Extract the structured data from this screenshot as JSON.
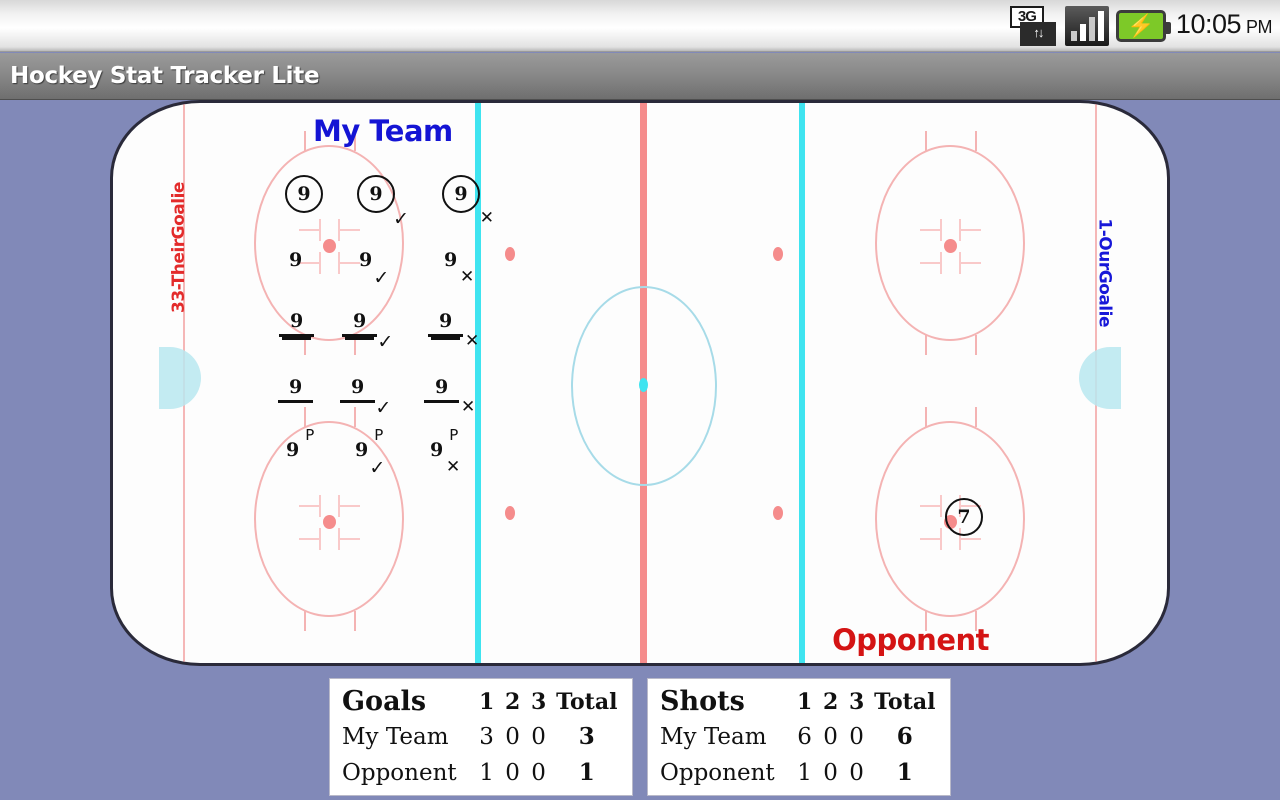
{
  "statusbar": {
    "network_label": "3G",
    "network_arrows": "↑↓",
    "battery_glyph": "⚡",
    "time": "10:05",
    "ampm": "PM"
  },
  "titlebar": {
    "app_title": "Hockey Stat Tracker Lite"
  },
  "rink": {
    "my_team_label": "My Team",
    "opponent_label": "Opponent",
    "their_goalie_label": "33-TheirGoalie",
    "our_goalie_label": "1-OurGoalie",
    "colors": {
      "background": "#8189b8",
      "ice": "#fdfdfd",
      "blue_line": "#3fe4f0",
      "red_line": "#f58c8c",
      "faceoff": "#f4b3b3",
      "crease": "#b8e8f0",
      "my_team": "#1414d4",
      "opponent": "#d41414"
    },
    "markers": [
      {
        "number": "9",
        "style": "circled",
        "mod": "",
        "penalty": false
      },
      {
        "number": "9",
        "style": "circled",
        "mod": "check",
        "penalty": false
      },
      {
        "number": "9",
        "style": "circled",
        "mod": "x",
        "penalty": false
      },
      {
        "number": "9",
        "style": "plain",
        "mod": "",
        "penalty": false
      },
      {
        "number": "9",
        "style": "plain",
        "mod": "check",
        "penalty": false
      },
      {
        "number": "9",
        "style": "plain",
        "mod": "x",
        "penalty": false
      },
      {
        "number": "9",
        "style": "dunderline",
        "mod": "",
        "penalty": false
      },
      {
        "number": "9",
        "style": "dunderline",
        "mod": "check",
        "penalty": false
      },
      {
        "number": "9",
        "style": "dunderline",
        "mod": "x",
        "penalty": false
      },
      {
        "number": "9",
        "style": "underline",
        "mod": "",
        "penalty": false
      },
      {
        "number": "9",
        "style": "underline",
        "mod": "check",
        "penalty": false
      },
      {
        "number": "9",
        "style": "underline",
        "mod": "x",
        "penalty": false
      },
      {
        "number": "9",
        "style": "plain",
        "mod": "",
        "penalty": true
      },
      {
        "number": "9",
        "style": "plain",
        "mod": "check",
        "penalty": true
      },
      {
        "number": "9",
        "style": "plain",
        "mod": "x",
        "penalty": true
      },
      {
        "number": "7",
        "style": "circled",
        "mod": "",
        "penalty": false
      }
    ],
    "marker_glyphs": {
      "check": "✓",
      "x": "✕",
      "penalty": "P"
    }
  },
  "tables": [
    {
      "title": "Goals",
      "period_headers": [
        "1",
        "2",
        "3"
      ],
      "total_header": "Total",
      "rows": [
        {
          "team": "My Team",
          "periods": [
            "3",
            "0",
            "0"
          ],
          "total": "3"
        },
        {
          "team": "Opponent",
          "periods": [
            "1",
            "0",
            "0"
          ],
          "total": "1"
        }
      ]
    },
    {
      "title": "Shots",
      "period_headers": [
        "1",
        "2",
        "3"
      ],
      "total_header": "Total",
      "rows": [
        {
          "team": "My Team",
          "periods": [
            "6",
            "0",
            "0"
          ],
          "total": "6"
        },
        {
          "team": "Opponent",
          "periods": [
            "1",
            "0",
            "0"
          ],
          "total": "1"
        }
      ]
    }
  ]
}
